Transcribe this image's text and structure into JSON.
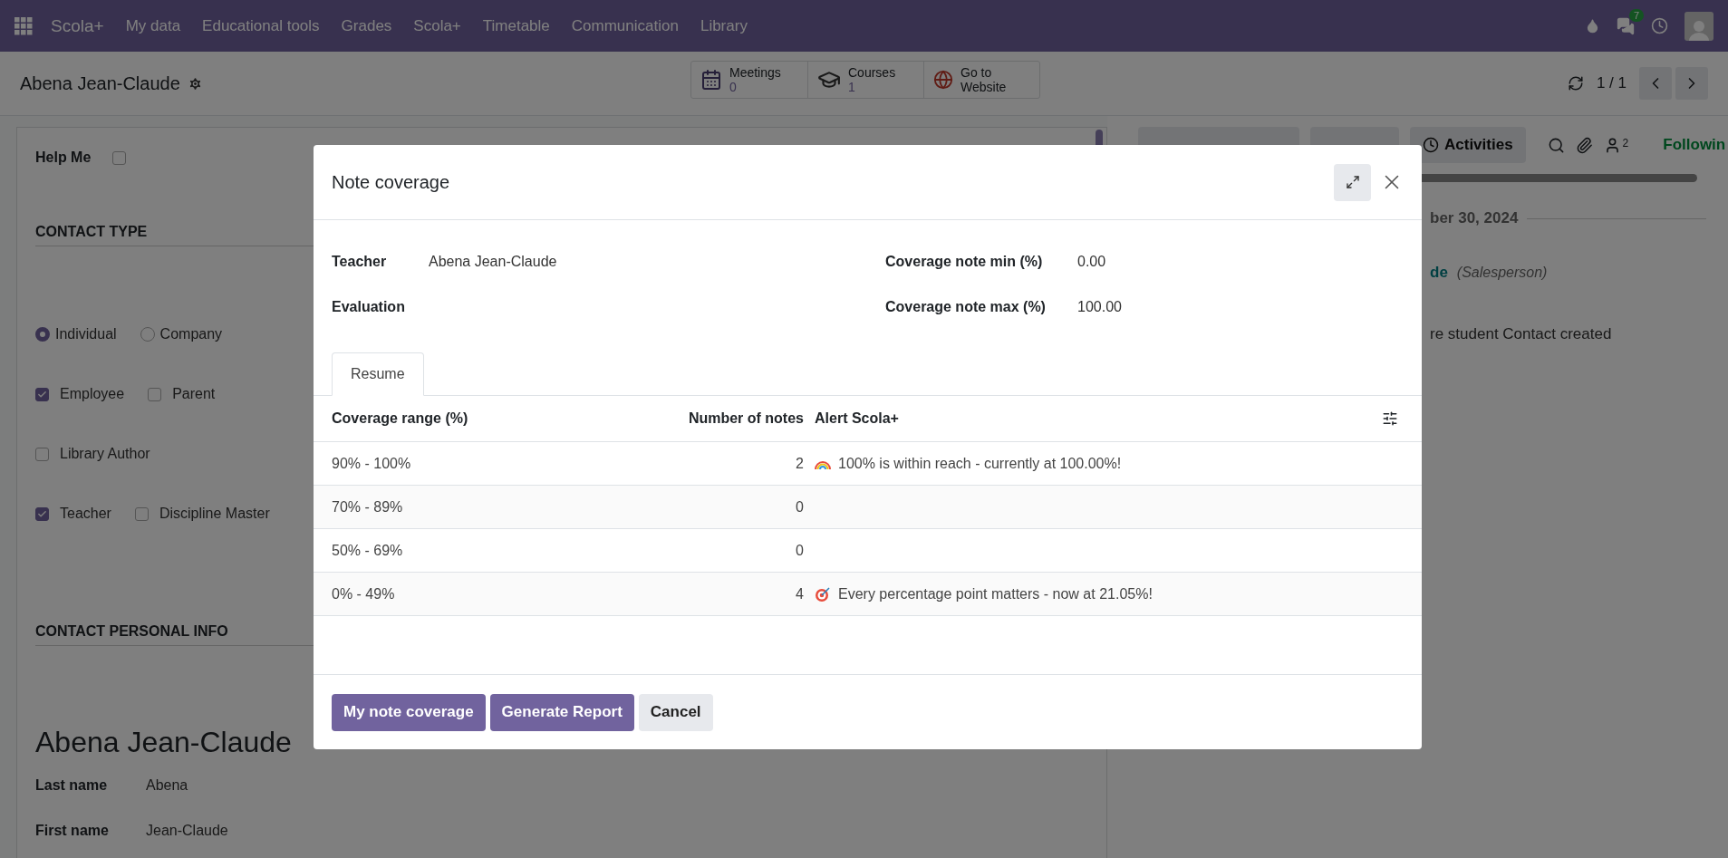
{
  "navbar": {
    "app_name": "Scola+",
    "menus": [
      "My data",
      "Educational tools",
      "Grades",
      "Scola+",
      "Timetable",
      "Communication",
      "Library"
    ],
    "messages_badge": "7"
  },
  "control_panel": {
    "record_title": "Abena Jean-Claude",
    "smart_buttons": [
      {
        "kind": "calendar",
        "label": "Meetings",
        "value": "0"
      },
      {
        "kind": "courses",
        "label": "Courses",
        "value": "1"
      },
      {
        "kind": "website",
        "label": "Go to",
        "value": "Website"
      }
    ],
    "pager": "1 / 1"
  },
  "form": {
    "help_me": {
      "label": "Help Me",
      "checked": false
    },
    "contact_type_title": "CONTACT TYPE",
    "type_options": [
      {
        "label": "Individual",
        "selected": true
      },
      {
        "label": "Company",
        "selected": false
      }
    ],
    "check_rows": [
      {
        "items": [
          {
            "label": "Employee",
            "checked": true
          },
          {
            "label": "Parent",
            "checked": false
          }
        ]
      },
      {
        "items": [
          {
            "label": "Library Author",
            "checked": false
          }
        ]
      },
      {
        "items": [
          {
            "label": "Teacher",
            "checked": true
          },
          {
            "label": "Discipline Master",
            "checked": false
          }
        ]
      }
    ],
    "personal_title": "CONTACT PERSONAL INFO",
    "name": "Abena Jean-Claude",
    "fields": [
      {
        "label": "Last name",
        "value": "Abena"
      },
      {
        "label": "First name",
        "value": "Jean-Claude"
      }
    ]
  },
  "chatter": {
    "buttons": [
      {
        "kind": "clock",
        "label": "Activities"
      }
    ],
    "followers_count": "2",
    "follow_label": "Followin",
    "date": "ber 30, 2024",
    "author": "de",
    "author_role": "(Salesperson)",
    "message": "re student Contact created"
  },
  "modal": {
    "title": "Note coverage",
    "fields_left": [
      {
        "label": "Teacher",
        "value": "Abena Jean-Claude"
      },
      {
        "label": "Evaluation"
      }
    ],
    "fields_right": [
      {
        "label": "Coverage note min (%)",
        "value": "0.00"
      },
      {
        "label": "Coverage note max (%)",
        "value": "100.00"
      }
    ],
    "tabs": [
      {
        "label": "Resume",
        "selected": true
      }
    ],
    "table": {
      "columns": [
        "Coverage range (%)",
        "Number of notes",
        "Alert Scola+"
      ],
      "rows": [
        {
          "range": "90% - 100%",
          "count": "2",
          "alert": {
            "kind": "rainbow",
            "text": "100% is within reach - currently at 100.00%!"
          }
        },
        {
          "range": "70% - 89%",
          "count": "0"
        },
        {
          "range": "50% - 69%",
          "count": "0"
        },
        {
          "range": "0% - 49%",
          "count": "4",
          "alert": {
            "kind": "target",
            "text": "Every percentage point matters - now at 21.05%!"
          }
        }
      ]
    },
    "buttons": [
      {
        "kind": "primary",
        "label": "My note coverage"
      },
      {
        "kind": "primary",
        "label": "Generate Report"
      },
      {
        "kind": "secondary",
        "label": "Cancel"
      }
    ]
  }
}
